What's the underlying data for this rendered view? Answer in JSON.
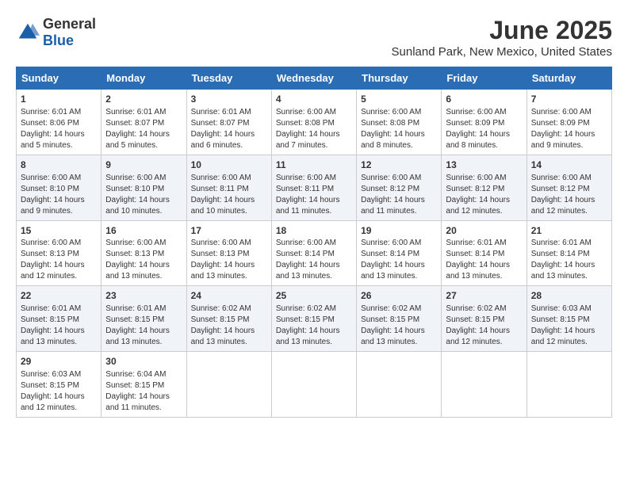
{
  "header": {
    "logo_general": "General",
    "logo_blue": "Blue",
    "title": "June 2025",
    "subtitle": "Sunland Park, New Mexico, United States"
  },
  "calendar": {
    "days_of_week": [
      "Sunday",
      "Monday",
      "Tuesday",
      "Wednesday",
      "Thursday",
      "Friday",
      "Saturday"
    ],
    "weeks": [
      [
        {
          "day": "1",
          "sunrise": "Sunrise: 6:01 AM",
          "sunset": "Sunset: 8:06 PM",
          "daylight": "Daylight: 14 hours and 5 minutes."
        },
        {
          "day": "2",
          "sunrise": "Sunrise: 6:01 AM",
          "sunset": "Sunset: 8:07 PM",
          "daylight": "Daylight: 14 hours and 5 minutes."
        },
        {
          "day": "3",
          "sunrise": "Sunrise: 6:01 AM",
          "sunset": "Sunset: 8:07 PM",
          "daylight": "Daylight: 14 hours and 6 minutes."
        },
        {
          "day": "4",
          "sunrise": "Sunrise: 6:00 AM",
          "sunset": "Sunset: 8:08 PM",
          "daylight": "Daylight: 14 hours and 7 minutes."
        },
        {
          "day": "5",
          "sunrise": "Sunrise: 6:00 AM",
          "sunset": "Sunset: 8:08 PM",
          "daylight": "Daylight: 14 hours and 8 minutes."
        },
        {
          "day": "6",
          "sunrise": "Sunrise: 6:00 AM",
          "sunset": "Sunset: 8:09 PM",
          "daylight": "Daylight: 14 hours and 8 minutes."
        },
        {
          "day": "7",
          "sunrise": "Sunrise: 6:00 AM",
          "sunset": "Sunset: 8:09 PM",
          "daylight": "Daylight: 14 hours and 9 minutes."
        }
      ],
      [
        {
          "day": "8",
          "sunrise": "Sunrise: 6:00 AM",
          "sunset": "Sunset: 8:10 PM",
          "daylight": "Daylight: 14 hours and 9 minutes."
        },
        {
          "day": "9",
          "sunrise": "Sunrise: 6:00 AM",
          "sunset": "Sunset: 8:10 PM",
          "daylight": "Daylight: 14 hours and 10 minutes."
        },
        {
          "day": "10",
          "sunrise": "Sunrise: 6:00 AM",
          "sunset": "Sunset: 8:11 PM",
          "daylight": "Daylight: 14 hours and 10 minutes."
        },
        {
          "day": "11",
          "sunrise": "Sunrise: 6:00 AM",
          "sunset": "Sunset: 8:11 PM",
          "daylight": "Daylight: 14 hours and 11 minutes."
        },
        {
          "day": "12",
          "sunrise": "Sunrise: 6:00 AM",
          "sunset": "Sunset: 8:12 PM",
          "daylight": "Daylight: 14 hours and 11 minutes."
        },
        {
          "day": "13",
          "sunrise": "Sunrise: 6:00 AM",
          "sunset": "Sunset: 8:12 PM",
          "daylight": "Daylight: 14 hours and 12 minutes."
        },
        {
          "day": "14",
          "sunrise": "Sunrise: 6:00 AM",
          "sunset": "Sunset: 8:12 PM",
          "daylight": "Daylight: 14 hours and 12 minutes."
        }
      ],
      [
        {
          "day": "15",
          "sunrise": "Sunrise: 6:00 AM",
          "sunset": "Sunset: 8:13 PM",
          "daylight": "Daylight: 14 hours and 12 minutes."
        },
        {
          "day": "16",
          "sunrise": "Sunrise: 6:00 AM",
          "sunset": "Sunset: 8:13 PM",
          "daylight": "Daylight: 14 hours and 13 minutes."
        },
        {
          "day": "17",
          "sunrise": "Sunrise: 6:00 AM",
          "sunset": "Sunset: 8:13 PM",
          "daylight": "Daylight: 14 hours and 13 minutes."
        },
        {
          "day": "18",
          "sunrise": "Sunrise: 6:00 AM",
          "sunset": "Sunset: 8:14 PM",
          "daylight": "Daylight: 14 hours and 13 minutes."
        },
        {
          "day": "19",
          "sunrise": "Sunrise: 6:00 AM",
          "sunset": "Sunset: 8:14 PM",
          "daylight": "Daylight: 14 hours and 13 minutes."
        },
        {
          "day": "20",
          "sunrise": "Sunrise: 6:01 AM",
          "sunset": "Sunset: 8:14 PM",
          "daylight": "Daylight: 14 hours and 13 minutes."
        },
        {
          "day": "21",
          "sunrise": "Sunrise: 6:01 AM",
          "sunset": "Sunset: 8:14 PM",
          "daylight": "Daylight: 14 hours and 13 minutes."
        }
      ],
      [
        {
          "day": "22",
          "sunrise": "Sunrise: 6:01 AM",
          "sunset": "Sunset: 8:15 PM",
          "daylight": "Daylight: 14 hours and 13 minutes."
        },
        {
          "day": "23",
          "sunrise": "Sunrise: 6:01 AM",
          "sunset": "Sunset: 8:15 PM",
          "daylight": "Daylight: 14 hours and 13 minutes."
        },
        {
          "day": "24",
          "sunrise": "Sunrise: 6:02 AM",
          "sunset": "Sunset: 8:15 PM",
          "daylight": "Daylight: 14 hours and 13 minutes."
        },
        {
          "day": "25",
          "sunrise": "Sunrise: 6:02 AM",
          "sunset": "Sunset: 8:15 PM",
          "daylight": "Daylight: 14 hours and 13 minutes."
        },
        {
          "day": "26",
          "sunrise": "Sunrise: 6:02 AM",
          "sunset": "Sunset: 8:15 PM",
          "daylight": "Daylight: 14 hours and 13 minutes."
        },
        {
          "day": "27",
          "sunrise": "Sunrise: 6:02 AM",
          "sunset": "Sunset: 8:15 PM",
          "daylight": "Daylight: 14 hours and 12 minutes."
        },
        {
          "day": "28",
          "sunrise": "Sunrise: 6:03 AM",
          "sunset": "Sunset: 8:15 PM",
          "daylight": "Daylight: 14 hours and 12 minutes."
        }
      ],
      [
        {
          "day": "29",
          "sunrise": "Sunrise: 6:03 AM",
          "sunset": "Sunset: 8:15 PM",
          "daylight": "Daylight: 14 hours and 12 minutes."
        },
        {
          "day": "30",
          "sunrise": "Sunrise: 6:04 AM",
          "sunset": "Sunset: 8:15 PM",
          "daylight": "Daylight: 14 hours and 11 minutes."
        },
        null,
        null,
        null,
        null,
        null
      ]
    ]
  }
}
